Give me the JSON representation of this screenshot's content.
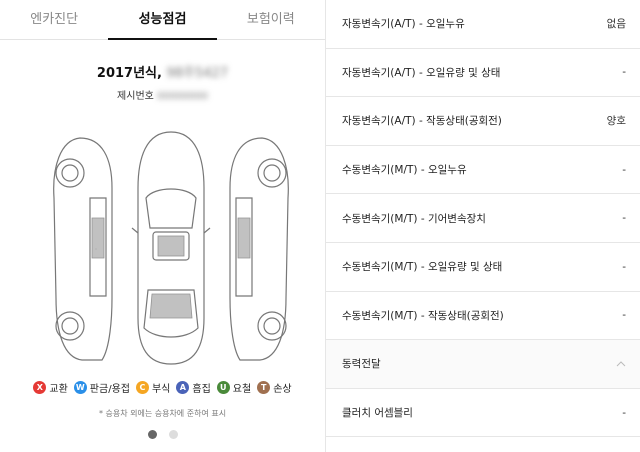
{
  "tabs": [
    {
      "label": "엔카진단"
    },
    {
      "label": "성능점검"
    },
    {
      "label": "보험이력"
    }
  ],
  "car": {
    "title": "2017년식,",
    "plate_blurred": "98주5427",
    "reg_label": "제시번호",
    "reg_blurred": "00000000"
  },
  "legend": [
    {
      "letter": "X",
      "label": "교환",
      "color": "#e53935"
    },
    {
      "letter": "W",
      "label": "판금/용접",
      "color": "#2a8fe8"
    },
    {
      "letter": "C",
      "label": "부식",
      "color": "#f5a623"
    },
    {
      "letter": "A",
      "label": "흠집",
      "color": "#4a63b8"
    },
    {
      "letter": "U",
      "label": "요철",
      "color": "#4a8a3a"
    },
    {
      "letter": "T",
      "label": "손상",
      "color": "#a07050"
    }
  ],
  "note": "* 승용차 외에는 승용차에 준하여 표시",
  "pager": {
    "total": 2,
    "current": 1
  },
  "rows": [
    {
      "label": "자동변속기(A/T) - 오일누유",
      "value": "없음"
    },
    {
      "label": "자동변속기(A/T) - 오일유량 및 상태",
      "value": "-"
    },
    {
      "label": "자동변속기(A/T) - 작동상태(공회전)",
      "value": "양호"
    },
    {
      "label": "수동변속기(M/T) - 오일누유",
      "value": "-"
    },
    {
      "label": "수동변속기(M/T) - 기어변속장치",
      "value": "-"
    },
    {
      "label": "수동변속기(M/T) - 오일유량 및 상태",
      "value": "-"
    },
    {
      "label": "수동변속기(M/T) - 작동상태(공회전)",
      "value": "-"
    },
    {
      "label": "동력전달",
      "value": ""
    },
    {
      "label": "클러치 어셈블리",
      "value": "-"
    }
  ],
  "icons": {
    "section_toggle": "chevron-up-icon"
  }
}
